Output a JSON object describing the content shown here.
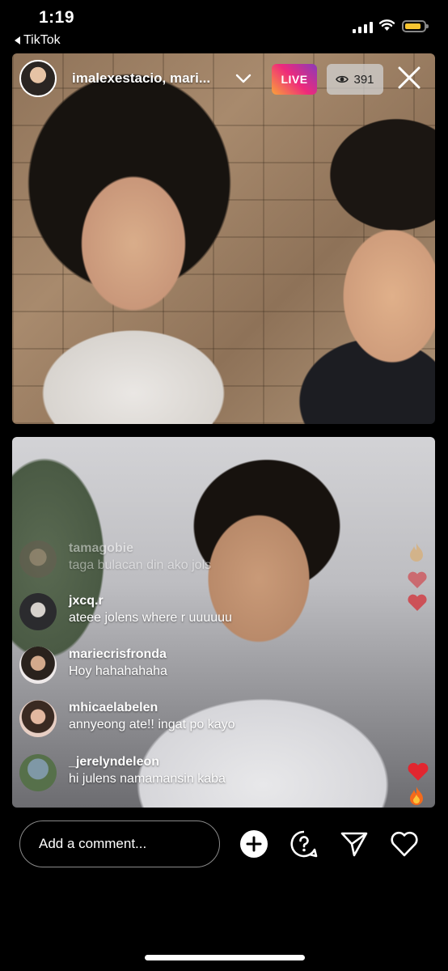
{
  "status_bar": {
    "time": "1:19",
    "back_app": "TikTok"
  },
  "live": {
    "host_names": "imalexestacio, mari...",
    "live_badge": "LIVE",
    "viewer_count": "391",
    "live_gradient": [
      "#f9a23a",
      "#ee2a7b",
      "#8a3ab9"
    ]
  },
  "comments": [
    {
      "username": "tamagobie",
      "message": "taga bulacan din ako jols"
    },
    {
      "username": "jxcq.r",
      "message": "ateee jolens where r uuuuuu"
    },
    {
      "username": "mariecrisfronda",
      "message": "Hoy hahahahaha"
    },
    {
      "username": "mhicaelabelen",
      "message": "annyeong ate!! ingat po kayo"
    },
    {
      "username": "_jerelyndeleon",
      "message": "hi julens namamansin kaba"
    }
  ],
  "bottom_bar": {
    "comment_placeholder": "Add a comment..."
  },
  "icons": [
    "back-arrow-icon",
    "signal-icon",
    "wifi-icon",
    "battery-icon",
    "chevron-down-icon",
    "eye-icon",
    "close-icon",
    "heart-icon",
    "fire-icon",
    "add-icon",
    "question-icon",
    "send-icon",
    "like-icon"
  ]
}
